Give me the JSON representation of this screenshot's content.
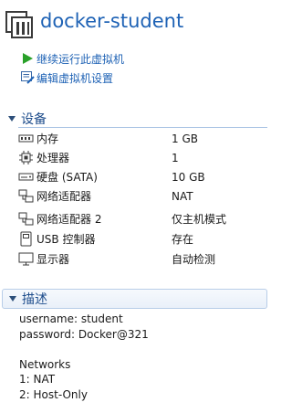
{
  "vm": {
    "title": "docker-student"
  },
  "actions": [
    {
      "label": "继续运行此虚拟机",
      "icon": "play-icon"
    },
    {
      "label": "编辑虚拟机设置",
      "icon": "edit-settings-icon"
    }
  ],
  "devices": {
    "title": "设备",
    "items": [
      {
        "name": "内存",
        "value": "1 GB",
        "icon": "memory-icon"
      },
      {
        "name": "处理器",
        "value": "1",
        "icon": "processor-icon"
      },
      {
        "name": "硬盘 (SATA)",
        "value": "10 GB",
        "icon": "hard-disk-icon"
      },
      {
        "name": "网络适配器",
        "value": "NAT",
        "icon": "network-adapter-icon"
      },
      {
        "name": "网络适配器 2",
        "value": "仅主机模式",
        "icon": "network-adapter-icon"
      },
      {
        "name": "USB 控制器",
        "value": "存在",
        "icon": "usb-icon"
      },
      {
        "name": "显示器",
        "value": "自动检测",
        "icon": "display-icon"
      }
    ]
  },
  "description": {
    "title": "描述",
    "lines": [
      "username: student",
      "password: Docker@321",
      "",
      "Networks",
      "1: NAT",
      "2: Host-Only"
    ]
  },
  "colors": {
    "title": "#1e62b5",
    "section": "#1e4d8c",
    "action": "#1e62b5",
    "play": "#2aa12a"
  }
}
